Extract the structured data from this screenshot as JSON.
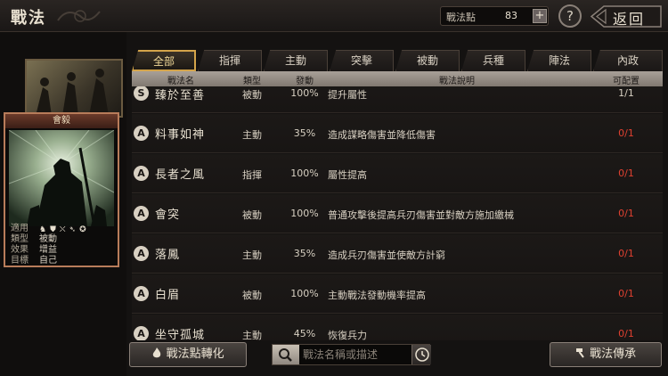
{
  "header": {
    "title": "戰法",
    "points_label": "戰法點",
    "points_value": "83",
    "plus": "+",
    "help": "?",
    "back_label": "返回"
  },
  "card": {
    "title": "會毅",
    "info": [
      {
        "k": "適用",
        "v": ""
      },
      {
        "k": "類型",
        "v": "被動"
      },
      {
        "k": "效果",
        "v": "增益"
      },
      {
        "k": "目標",
        "v": "自己"
      }
    ]
  },
  "tabs": [
    "全部",
    "指揮",
    "主動",
    "突擊",
    "被動",
    "兵種",
    "陣法",
    "內政"
  ],
  "active_tab": 0,
  "columns": {
    "name": "戰法名",
    "type": "類型",
    "rate": "發動",
    "desc": "戰法說明",
    "cfg": "可配置"
  },
  "rows": [
    {
      "grade": "S",
      "name": "臻於至善",
      "type": "被動",
      "rate": "100%",
      "desc": "提升屬性",
      "cfg": "1/1",
      "cfg_red": false
    },
    {
      "grade": "A",
      "name": "料事如神",
      "type": "主動",
      "rate": "35%",
      "desc": "造成謀略傷害並降低傷害",
      "cfg": "0/1",
      "cfg_red": true
    },
    {
      "grade": "A",
      "name": "長者之風",
      "type": "指揮",
      "rate": "100%",
      "desc": "屬性提高",
      "cfg": "0/1",
      "cfg_red": true
    },
    {
      "grade": "A",
      "name": "會突",
      "type": "被動",
      "rate": "100%",
      "desc": "普通攻擊後提高兵刃傷害並對敵方施加繳械",
      "cfg": "0/1",
      "cfg_red": true
    },
    {
      "grade": "A",
      "name": "落鳳",
      "type": "主動",
      "rate": "35%",
      "desc": "造成兵刃傷害並使敵方計窮",
      "cfg": "0/1",
      "cfg_red": true
    },
    {
      "grade": "A",
      "name": "白眉",
      "type": "被動",
      "rate": "100%",
      "desc": "主動戰法發動機率提高",
      "cfg": "0/1",
      "cfg_red": true
    },
    {
      "grade": "A",
      "name": "坐守孤城",
      "type": "主動",
      "rate": "45%",
      "desc": "恢復兵力",
      "cfg": "0/1",
      "cfg_red": true
    }
  ],
  "footer": {
    "convert": "戰法點轉化",
    "search_placeholder": "戰法名稱或描述",
    "inherit": "戰法傳承"
  },
  "colors": {
    "accent": "#d4a44a",
    "red": "#e04030"
  }
}
